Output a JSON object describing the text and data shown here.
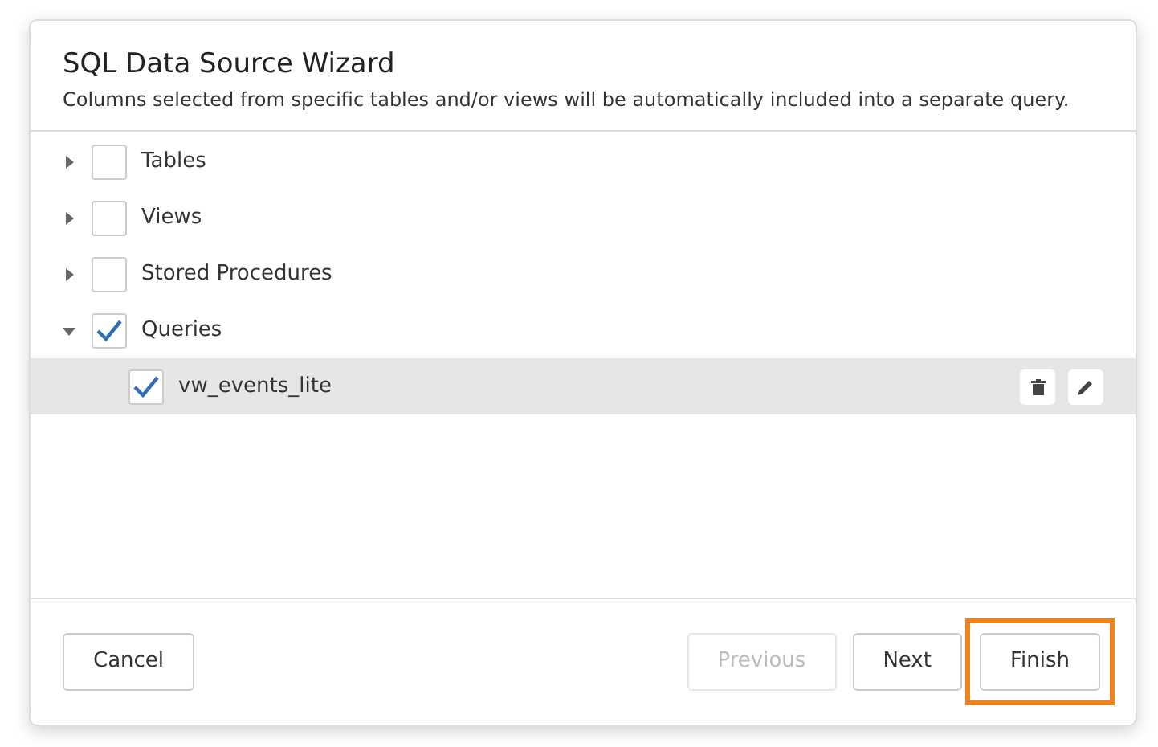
{
  "dialog": {
    "title": "SQL Data Source Wizard",
    "description": "Columns selected from specific tables and/or views will be automatically included into a separate query."
  },
  "tree": [
    {
      "label": "Tables",
      "expanded": false,
      "checked": false
    },
    {
      "label": "Views",
      "expanded": false,
      "checked": false
    },
    {
      "label": "Stored Procedures",
      "expanded": false,
      "checked": false
    },
    {
      "label": "Queries",
      "expanded": true,
      "checked": true,
      "children": [
        {
          "label": "vw_events_lite",
          "checked": true,
          "selected": true
        }
      ]
    }
  ],
  "buttons": [
    {
      "label": "Cancel",
      "disabled": false,
      "highlighted": false
    },
    {
      "label": "Previous",
      "disabled": true,
      "highlighted": false
    },
    {
      "label": "Next",
      "disabled": false,
      "highlighted": false
    },
    {
      "label": "Finish",
      "disabled": false,
      "highlighted": true
    }
  ]
}
